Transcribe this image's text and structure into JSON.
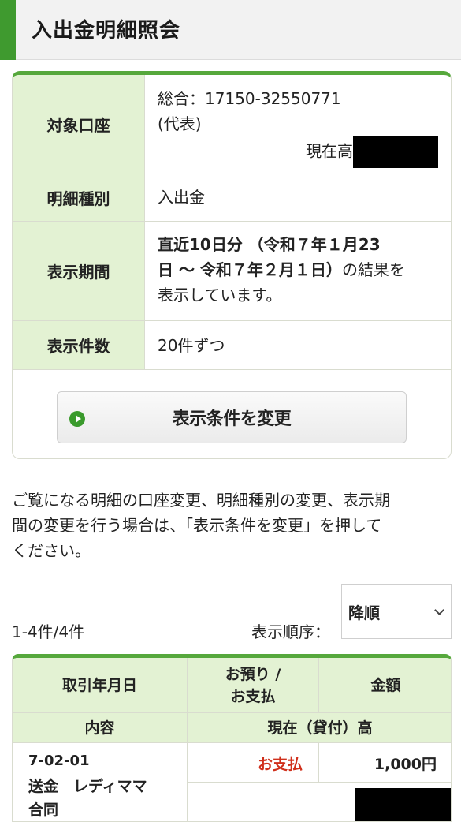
{
  "header": {
    "title": "入出金明細照会"
  },
  "summary": {
    "account": {
      "label": "対象口座",
      "line1": "総合：17150-32550771",
      "line2": "(代表)",
      "balance_label": "現在高"
    },
    "type": {
      "label": "明細種別",
      "value": "入出金"
    },
    "period": {
      "label": "表示期間",
      "bold_line1": "直近10日分 （令和７年１月23",
      "bold_line2": "日 〜 令和７年２月１日）",
      "suffix": "の結果を",
      "line3": "表示しています。"
    },
    "count": {
      "label": "表示件数",
      "value": "20件ずつ"
    },
    "change_button": "表示条件を変更"
  },
  "info": {
    "line1": "ご覧になる明細の口座変更、明細種別の変更、表示期",
    "line2": "間の変更を行う場合は、「表示条件を変更」を押して",
    "line3": "ください。"
  },
  "list_controls": {
    "count_text": "1-4件/4件",
    "sort_label": "表示順序：",
    "sort_value": "降順"
  },
  "table": {
    "headers": {
      "date": "取引年月日",
      "type_line1": "お預り /",
      "type_line2": "お支払",
      "amount": "金額",
      "content": "内容",
      "balance": "現在（貸付）高"
    },
    "rows": [
      {
        "date": "7-02-01",
        "desc_line1": "送金　レディママ",
        "desc_line2": "合同",
        "type": "お支払",
        "amount": "1,000円"
      }
    ]
  },
  "colors": {
    "accent_green": "#3f9a2f",
    "label_bg": "#e3f2d3",
    "payment_red": "#d0301c"
  }
}
